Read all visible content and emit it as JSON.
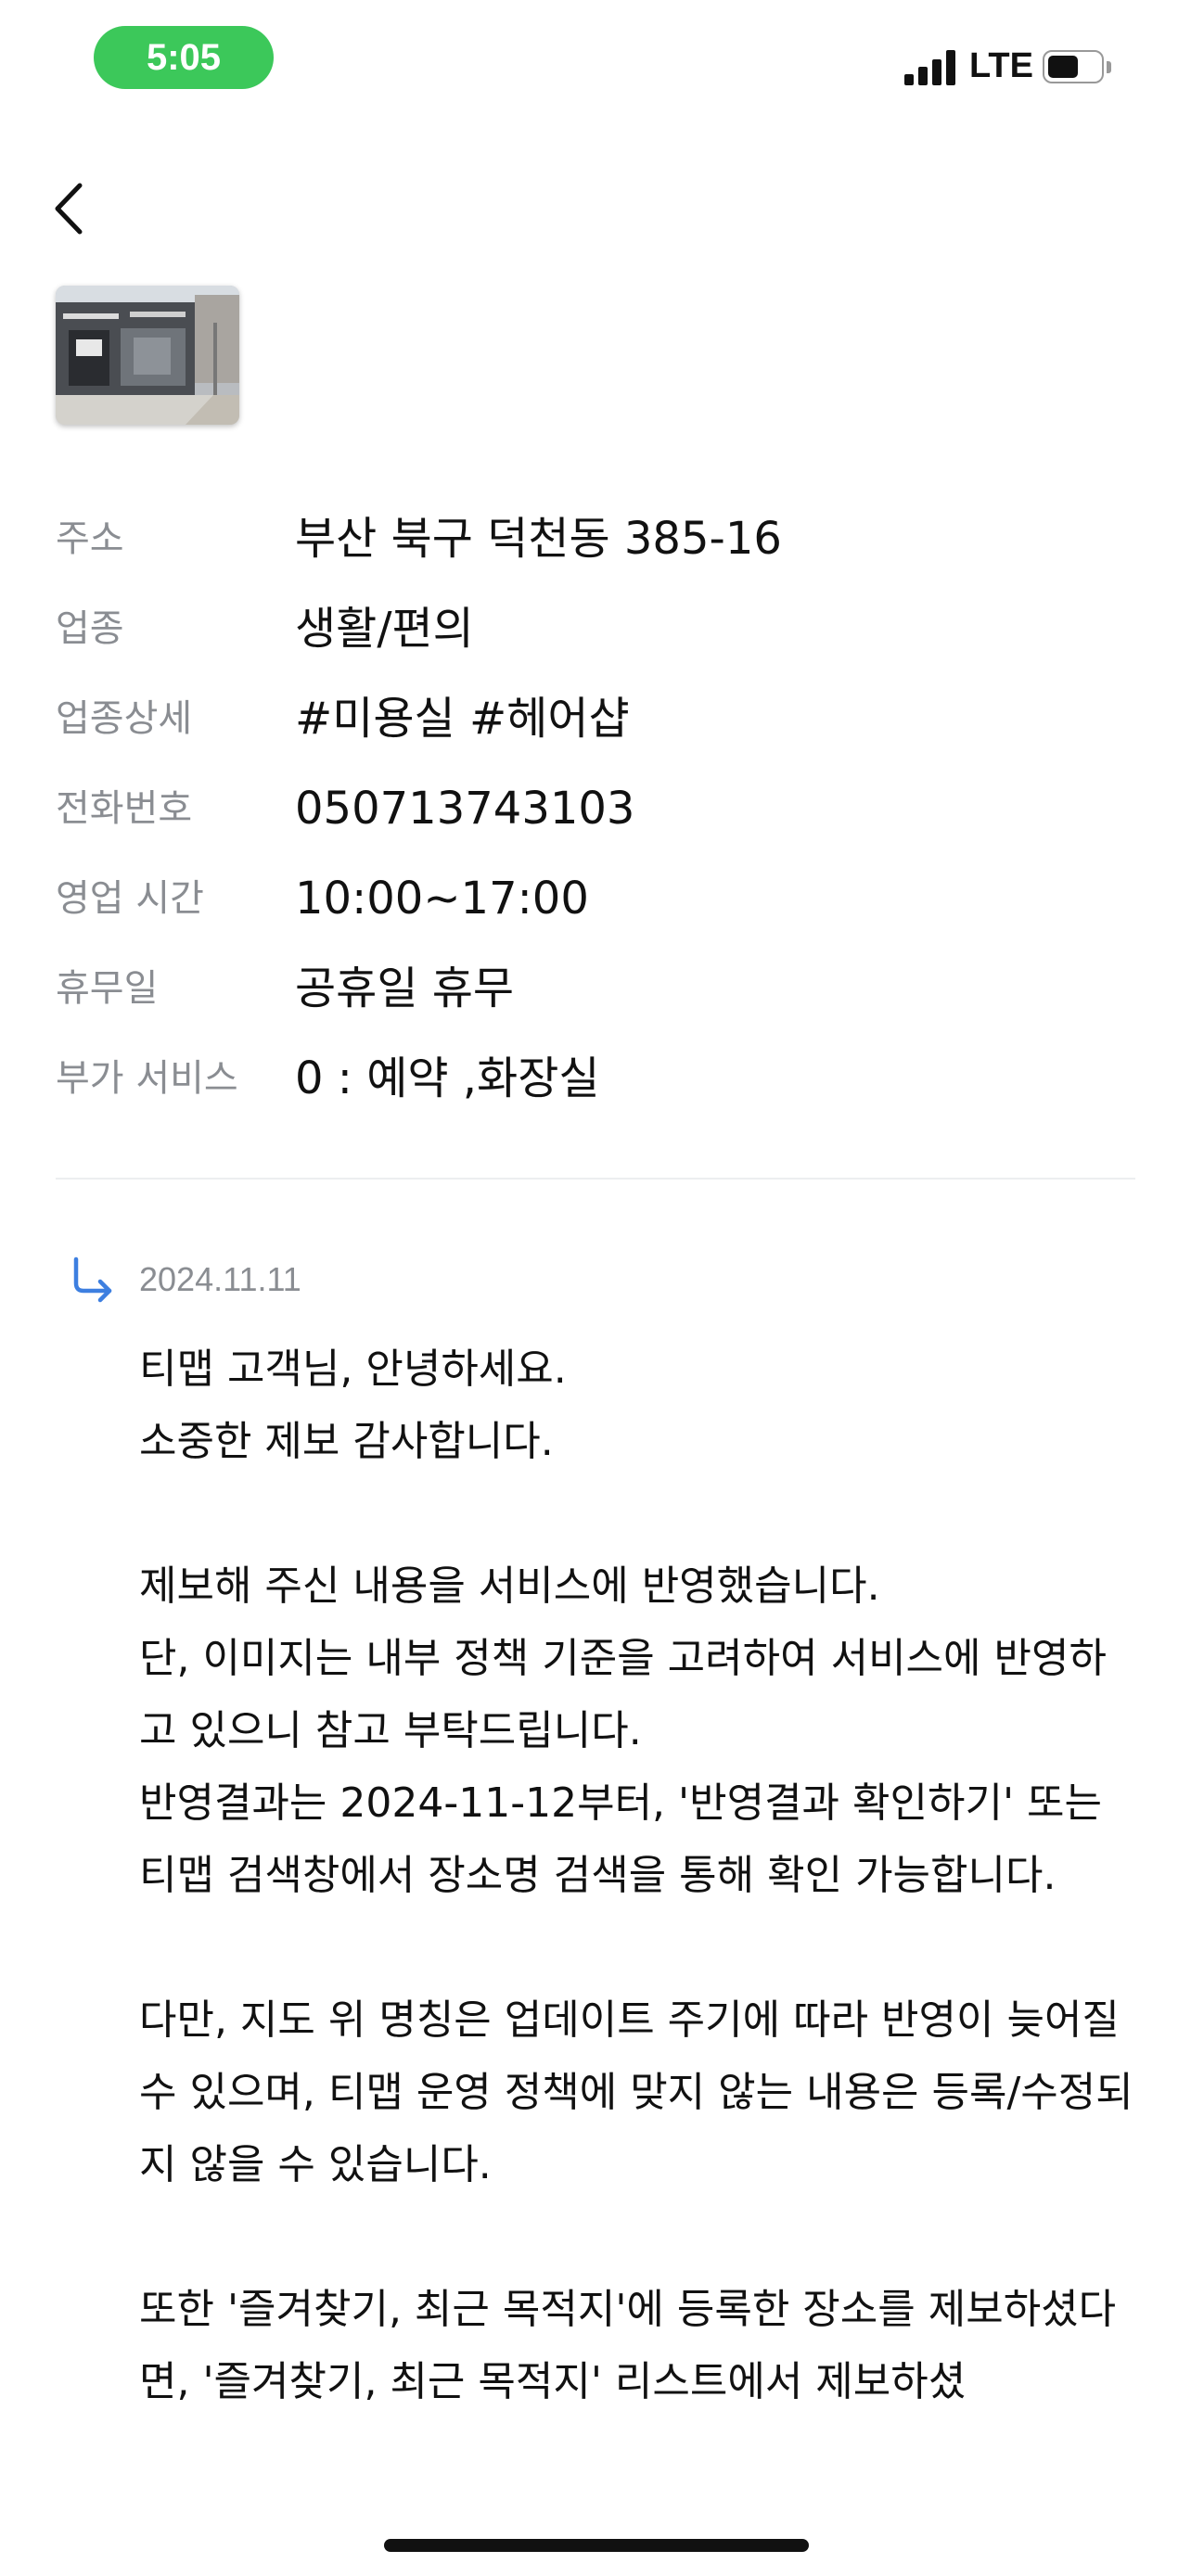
{
  "status_bar": {
    "time": "5:05",
    "network": "LTE",
    "battery_level": 0.6,
    "signal_bars": 4,
    "accent_color": "#3cc85a"
  },
  "nav": {
    "back_icon": "chevron-left-icon"
  },
  "place_info": [
    {
      "label": "주소",
      "value": "부산 북구 덕천동 385-16"
    },
    {
      "label": "업종",
      "value": "생활/편의"
    },
    {
      "label": "업종상세",
      "value": "#미용실 #헤어샵"
    },
    {
      "label": "전화번호",
      "value": "050713743103"
    },
    {
      "label": "영업 시간",
      "value": "10:00~17:00"
    },
    {
      "label": "휴무일",
      "value": "공휴일 휴무"
    },
    {
      "label": "부가 서비스",
      "value": "0 : 예약 ,화장실"
    }
  ],
  "reply": {
    "icon": "reply-arrow-icon",
    "date": "2024.11.11",
    "body": "티맵 고객님, 안녕하세요.\n소중한 제보 감사합니다.\n\n제보해 주신 내용을 서비스에 반영했습니다.\n단, 이미지는 내부 정책 기준을 고려하여 서비스에 반영하고 있으니 참고 부탁드립니다.\n반영결과는 2024-11-12부터, '반영결과 확인하기' 또는 티맵 검색창에서 장소명 검색을 통해 확인 가능합니다.\n\n다만, 지도 위 명칭은 업데이트 주기에 따라 반영이 늦어질 수 있으며, 티맵 운영 정책에 맞지 않는 내용은 등록/수정되지 않을 수 있습니다.\n\n또한 '즐겨찾기, 최근 목적지'에 등록한 장소를 제보하셨다면, '즐겨찾기, 최근 목적지' 리스트에서 제보하셨",
    "accent_color": "#3d7fe0"
  }
}
